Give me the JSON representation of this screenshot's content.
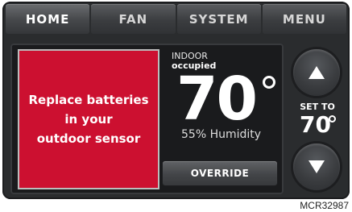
{
  "nav": {
    "tabs": [
      "HOME",
      "FAN",
      "SYSTEM",
      "MENU"
    ]
  },
  "alert": {
    "line1": "Replace batteries",
    "line2": "in your",
    "line3": "outdoor sensor",
    "color": "#cc1030"
  },
  "indoor": {
    "label": "INDOOR",
    "status": "occupied",
    "temperature": "70",
    "humidity": "55% Humidity"
  },
  "override": {
    "label": "OVERRIDE"
  },
  "setpoint": {
    "label": "SET TO",
    "value": "70"
  },
  "buttons": {
    "up_icon": "triangle-up-icon",
    "down_icon": "triangle-down-icon"
  },
  "figure": {
    "code": "MCR32987"
  }
}
